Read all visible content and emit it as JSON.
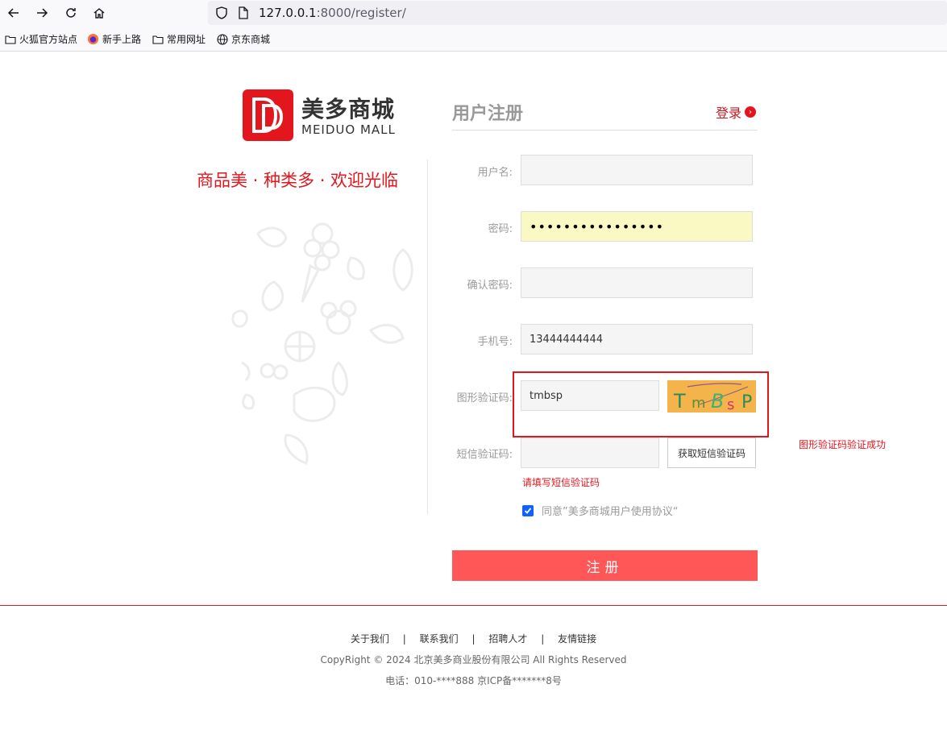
{
  "browser": {
    "url_host": "127.0.0.1",
    "url_rest": ":8000/register/"
  },
  "bookmarks": [
    {
      "label": "火狐官方站点"
    },
    {
      "label": "新手上路"
    },
    {
      "label": "常用网址"
    },
    {
      "label": "京东商城"
    }
  ],
  "brand": {
    "name_cn": "美多商城",
    "name_en": "MEIDUO MALL",
    "slogan": "商品美 · 种类多 · 欢迎光临"
  },
  "form": {
    "title": "用户注册",
    "login_label": "登录",
    "fields": {
      "username": {
        "label": "用户名:",
        "value": ""
      },
      "password": {
        "label": "密码:",
        "value": "••••••••••••••••"
      },
      "confirm_password": {
        "label": "确认密码:",
        "value": ""
      },
      "phone": {
        "label": "手机号:",
        "value": "13444444444"
      },
      "image_code": {
        "label": "图形验证码:",
        "value": "tmbsp"
      },
      "sms_code": {
        "label": "短信验证码:",
        "value": ""
      }
    },
    "captcha_text": "TmBsP",
    "image_code_success": "图形验证码验证成功",
    "sms_button": "获取短信验证码",
    "sms_error": "请填写短信验证码",
    "agree_label": "同意”美多商城用户使用协议“",
    "agree_checked": true,
    "submit_label": "注册"
  },
  "footer": {
    "links": [
      "关于我们",
      "联系我们",
      "招聘人才",
      "友情链接"
    ],
    "separator": "|",
    "copyright": "CopyRight © 2024 北京美多商业股份有限公司 All Rights Reserved",
    "tel": "电话：010-****888 京ICP备*******8号"
  },
  "colors": {
    "brand_red": "#e4161d",
    "submit_bg": "#ff5757",
    "captcha_bg": "#f5b34b"
  }
}
